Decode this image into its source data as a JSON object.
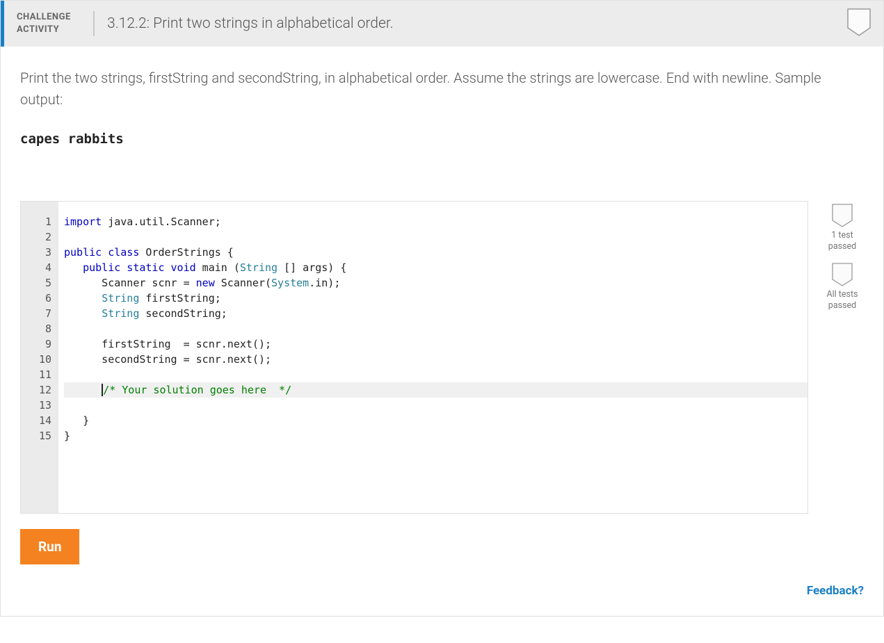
{
  "header": {
    "label_line1": "CHALLENGE",
    "label_line2": "ACTIVITY",
    "title": "3.12.2: Print two strings in alphabetical order."
  },
  "instructions": "Print the two strings, firstString and secondString, in alphabetical order. Assume the strings are lowercase. End with newline. Sample output:",
  "sample_output": "capes rabbits",
  "code": {
    "lines": [
      {
        "n": 1,
        "segs": [
          {
            "t": "import",
            "c": "kw"
          },
          {
            "t": " java.util.Scanner;",
            "c": "ident"
          }
        ]
      },
      {
        "n": 2,
        "segs": []
      },
      {
        "n": 3,
        "segs": [
          {
            "t": "public class",
            "c": "kw"
          },
          {
            "t": " OrderStrings {",
            "c": "ident"
          }
        ]
      },
      {
        "n": 4,
        "segs": [
          {
            "t": "   ",
            "c": ""
          },
          {
            "t": "public static void",
            "c": "kw"
          },
          {
            "t": " main (",
            "c": "ident"
          },
          {
            "t": "String",
            "c": "type"
          },
          {
            "t": " [] args) {",
            "c": "ident"
          }
        ]
      },
      {
        "n": 5,
        "segs": [
          {
            "t": "      Scanner scnr = ",
            "c": "ident"
          },
          {
            "t": "new",
            "c": "kw"
          },
          {
            "t": " Scanner(",
            "c": "ident"
          },
          {
            "t": "System",
            "c": "type"
          },
          {
            "t": ".in);",
            "c": "ident"
          }
        ]
      },
      {
        "n": 6,
        "segs": [
          {
            "t": "      ",
            "c": ""
          },
          {
            "t": "String",
            "c": "type"
          },
          {
            "t": " firstString;",
            "c": "ident"
          }
        ]
      },
      {
        "n": 7,
        "segs": [
          {
            "t": "      ",
            "c": ""
          },
          {
            "t": "String",
            "c": "type"
          },
          {
            "t": " secondString;",
            "c": "ident"
          }
        ]
      },
      {
        "n": 8,
        "segs": []
      },
      {
        "n": 9,
        "segs": [
          {
            "t": "      firstString  = scnr.next();",
            "c": "ident"
          }
        ]
      },
      {
        "n": 10,
        "segs": [
          {
            "t": "      secondString = scnr.next();",
            "c": "ident"
          }
        ]
      },
      {
        "n": 11,
        "segs": []
      },
      {
        "n": 12,
        "hl": true,
        "cursor": true,
        "segs": [
          {
            "t": "      ",
            "c": ""
          },
          {
            "t": "/* Your solution goes here  */",
            "c": "comment"
          }
        ]
      },
      {
        "n": 13,
        "segs": []
      },
      {
        "n": 14,
        "segs": [
          {
            "t": "   }",
            "c": "ident"
          }
        ]
      },
      {
        "n": 15,
        "segs": [
          {
            "t": "}",
            "c": "ident"
          }
        ]
      }
    ]
  },
  "results": {
    "r1": "1 test passed",
    "r2": "All tests passed"
  },
  "run_label": "Run",
  "feedback_label": "Feedback?"
}
